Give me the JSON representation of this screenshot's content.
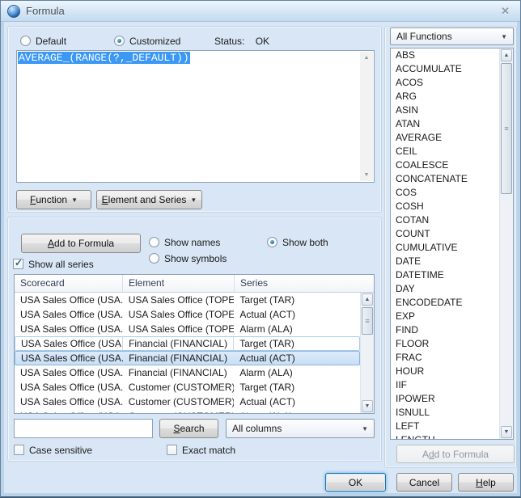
{
  "window": {
    "title": "Formula",
    "close_glyph": "✕"
  },
  "icons": {
    "dropdown_arrow": "▼",
    "scroll_up": "▲",
    "scroll_down": "▼",
    "thumb_grip": "≡"
  },
  "colors": {
    "selection_blue": "#3b98f5",
    "dialog_bg": "#d8e6f5",
    "titlebar_top": "#eef6fd",
    "row_selected_border": "#89b4e0"
  },
  "formula_section": {
    "radio_default": "Default",
    "radio_customized": "Customized",
    "status_label": "Status:",
    "status_value": "OK",
    "formula_text": "AVERAGE_(RANGE(?,_DEFAULT))",
    "function_button": "&Function",
    "element_series_button": "&Element and Series"
  },
  "series_section": {
    "add_to_formula_button": "&Add to Formula",
    "radio_show_names": "Show names",
    "radio_show_symbols": "Show symbols",
    "radio_show_both": "Show both",
    "checkbox_show_all_series": "Show all series",
    "table": {
      "columns": [
        "Scorecard",
        "Element",
        "Series"
      ],
      "rows": [
        [
          "USA Sales Office (USA...",
          "USA Sales Office (TOPE...",
          "Target (TAR)"
        ],
        [
          "USA Sales Office (USA...",
          "USA Sales Office (TOPE...",
          "Actual (ACT)"
        ],
        [
          "USA Sales Office (USA...",
          "USA Sales Office (TOPE...",
          "Alarm (ALA)"
        ],
        [
          "USA Sales Office (USA...",
          "Financial (FINANCIAL)",
          "Target (TAR)"
        ],
        [
          "USA Sales Office (USA...",
          "Financial (FINANCIAL)",
          "Actual (ACT)"
        ],
        [
          "USA Sales Office (USA...",
          "Financial (FINANCIAL)",
          "Alarm (ALA)"
        ],
        [
          "USA Sales Office (USA...",
          "Customer (CUSTOMER)",
          "Target (TAR)"
        ],
        [
          "USA Sales Office (USA...",
          "Customer (CUSTOMER)",
          "Actual (ACT)"
        ],
        [
          "USA Sales Office (USA...",
          "Customer (CUSTOMER)",
          "Alarm (ALA)"
        ]
      ],
      "focused_row_index": 3,
      "selected_row_index": 4
    },
    "search_value": "",
    "search_button": "&Search",
    "columns_dropdown_value": "All columns",
    "checkbox_case_sensitive": "Case sensitive",
    "checkbox_exact_match": "Exact match"
  },
  "functions_panel": {
    "filter_dropdown_value": "All Functions",
    "functions": [
      "ABS",
      "ACCUMULATE",
      "ACOS",
      "ARG",
      "ASIN",
      "ATAN",
      "AVERAGE",
      "CEIL",
      "COALESCE",
      "CONCATENATE",
      "COS",
      "COSH",
      "COTAN",
      "COUNT",
      "CUMULATIVE",
      "DATE",
      "DATETIME",
      "DAY",
      "ENCODEDATE",
      "EXP",
      "FIND",
      "FLOOR",
      "FRAC",
      "HOUR",
      "IIF",
      "IPOWER",
      "ISNULL",
      "LEFT",
      "LENGTH"
    ],
    "add_to_formula_button": "A&dd to Formula",
    "add_to_formula_enabled": false
  },
  "footer": {
    "ok_button": "OK",
    "cancel_button": "Cancel",
    "help_button": "&Help"
  }
}
